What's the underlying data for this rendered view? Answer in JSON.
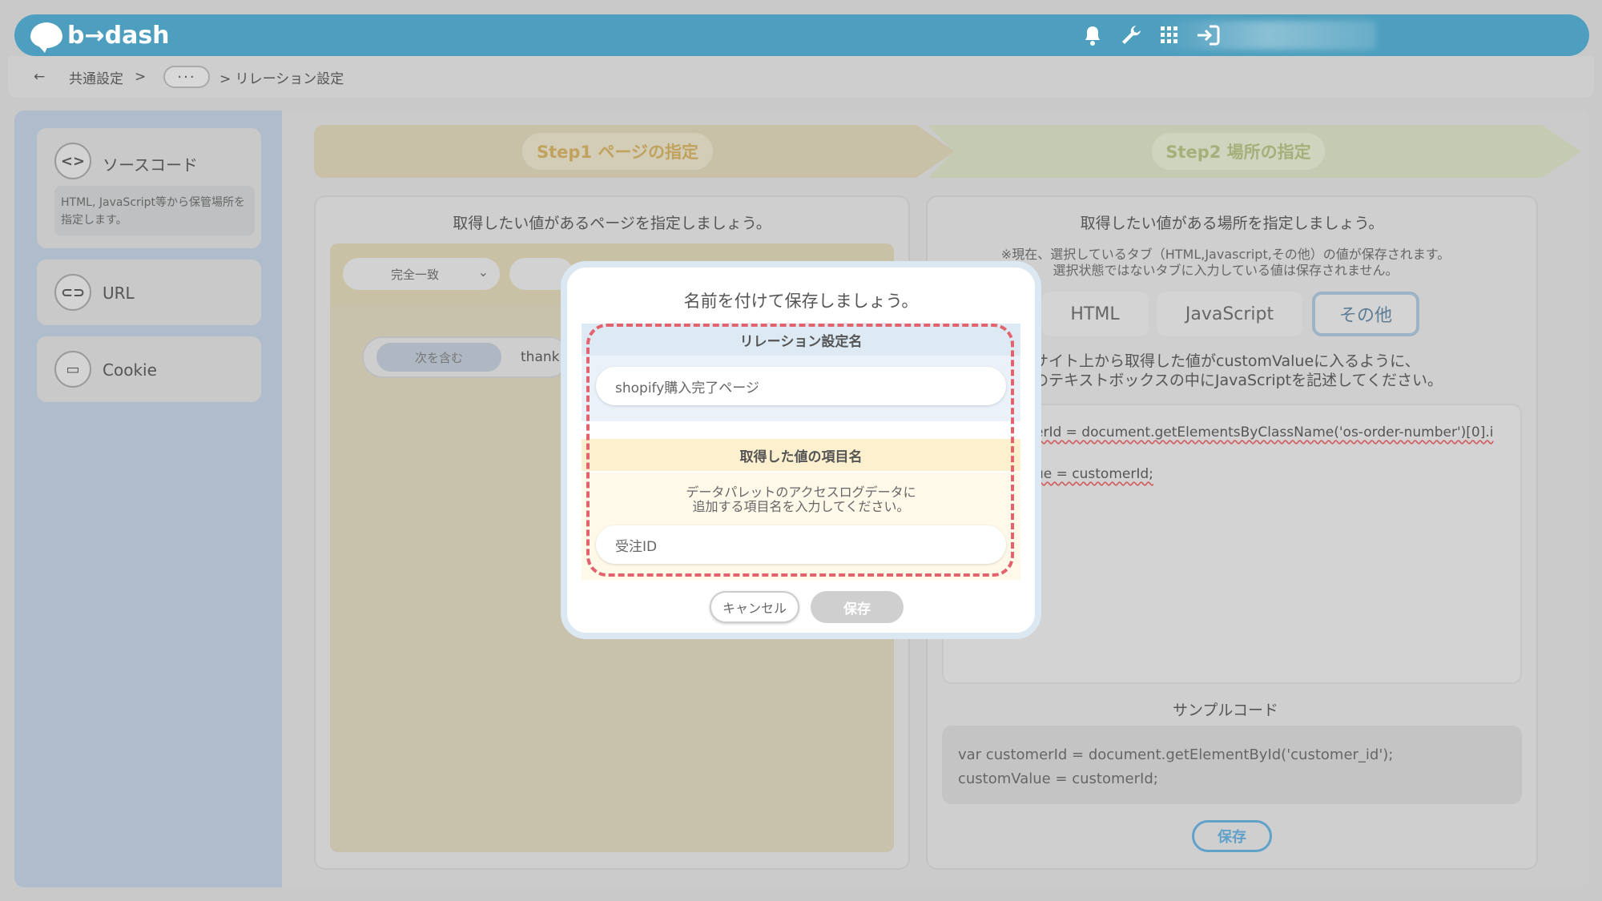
{
  "header": {
    "logo_text": "b→dash",
    "icons": [
      "bell-icon",
      "wrench-icon",
      "grid-icon",
      "logout-icon"
    ]
  },
  "breadcrumb": {
    "back": "←",
    "item1": "共通設定",
    "sep": ">",
    "more": "···",
    "current": "> リレーション設定"
  },
  "sidebar": {
    "items": [
      {
        "icon_glyph": "<>",
        "label": "ソースコード",
        "desc": "HTML, JavaScript等から保管場所を指定します。"
      },
      {
        "icon_glyph": "⊂⊃",
        "label": "URL"
      },
      {
        "icon_glyph": "▭",
        "label": "Cookie"
      }
    ]
  },
  "steps": {
    "step1": "Step1 ページの指定",
    "step2": "Step2 場所の指定"
  },
  "left_panel": {
    "title": "取得したい値があるページを指定しましょう。",
    "match_select": "完全一致",
    "rule_pill": "次を含む",
    "rule_value": "thank"
  },
  "right_panel": {
    "title": "取得したい値がある場所を指定しましょう。",
    "note_line1": "※現在、選択しているタブ（HTML,Javascript,その他）の値が保存されます。",
    "note_line2": "選択状態ではないタブに入力している値は保存されません。",
    "tabs": [
      "HTML",
      "JavaScript",
      "その他"
    ],
    "hint_line1": "サイト上から取得した値がcustomValueに入るように、",
    "hint_line2": "のテキストボックスの中にJavaScriptを記述してください。",
    "code_line1": "erId = document.getElementsByClassName('os-order-number')[0].i",
    "code_line2": "ue = customerId;",
    "sample_title": "サンプルコード",
    "sample_line1": "var customerId = document.getElementById('customer_id');",
    "sample_line2": "customValue = customerId;",
    "save_label": "保存"
  },
  "modal": {
    "title": "名前を付けて保存しましょう。",
    "section1_label": "リレーション設定名",
    "section1_value": "shopify購入完了ページ",
    "section2_label": "取得した値の項目名",
    "section2_desc_line1": "データパレットのアクセスログデータに",
    "section2_desc_line2": "追加する項目名を入力してください。",
    "section2_value": "受注ID",
    "cancel_label": "キャンセル",
    "save_label": "保存"
  },
  "colors": {
    "header_bg": "#4e9fbf",
    "highlight_dash": "#e2636e",
    "accent_blue": "#5fa1c9"
  }
}
